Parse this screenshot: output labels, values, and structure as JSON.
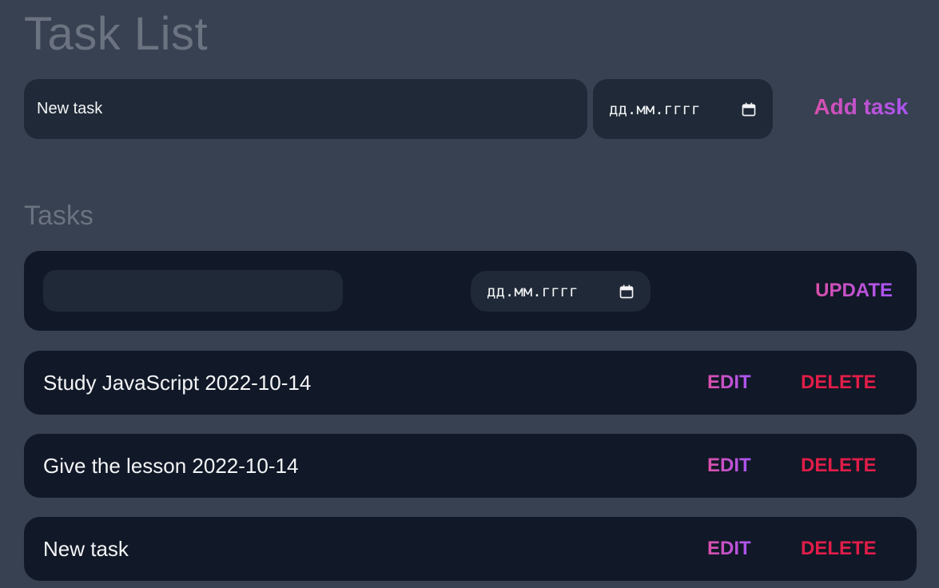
{
  "header": {
    "title": "Task List"
  },
  "new_task_form": {
    "task_value": "New task",
    "date_placeholder": "дд.мм.гггг",
    "add_label": "Add task"
  },
  "tasks_section": {
    "heading": "Tasks",
    "edit_form": {
      "task_value": "",
      "date_placeholder": "дд.мм.гггг",
      "update_label": "UPDATE"
    },
    "items": [
      {
        "text": "Study JavaScript 2022-10-14",
        "edit_label": "EDIT",
        "delete_label": "DELETE"
      },
      {
        "text": "Give the lesson 2022-10-14",
        "edit_label": "EDIT",
        "delete_label": "DELETE"
      },
      {
        "text": "New task",
        "edit_label": "EDIT",
        "delete_label": "DELETE"
      }
    ]
  },
  "icons": {
    "date_picker": "calendar-icon"
  },
  "colors": {
    "page_bg": "#374151",
    "card_bg": "#111827",
    "input_bg": "#1f2937",
    "accent_from": "#db4fa8",
    "accent_to": "#a855f7",
    "danger": "#e11d48"
  }
}
